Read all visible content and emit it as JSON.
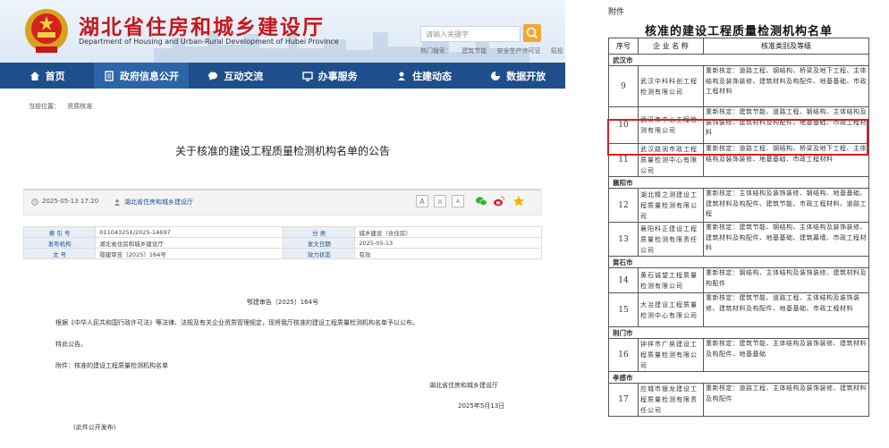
{
  "header": {
    "title": "湖北省住房和城乡建设厅",
    "subtitle": "Department of Housing and Urban-Rural Development of Hubei Province",
    "search_placeholder": "请输入关键字",
    "hotwords": [
      "热门搜索：",
      "建筑节能",
      "安全生产许可证",
      "招投",
      "业务"
    ]
  },
  "nav": {
    "items": [
      {
        "label": "首页",
        "icon": "home-icon"
      },
      {
        "label": "政府信息公开",
        "icon": "document-icon"
      },
      {
        "label": "互动交流",
        "icon": "chat-icon"
      },
      {
        "label": "办事服务",
        "icon": "monitor-icon"
      },
      {
        "label": "住建动态",
        "icon": "person-icon"
      },
      {
        "label": "数据开放",
        "icon": "pie-chart-icon"
      }
    ]
  },
  "breadcrumb": [
    "当前位置：",
    "资质核准"
  ],
  "article": {
    "title": "关于核准的建设工程质量检测机构名单的公告",
    "date": "2025-05-13 17:20",
    "source": "湖北省住房和城乡建设厅",
    "font_sizes": [
      "A",
      "A",
      "A"
    ],
    "info": {
      "index_label": "索 引 号",
      "index_value": "01104325X/2025-14697",
      "category_label": "分 类",
      "category_value": "城乡建设（含住房）",
      "issuer_label": "发布机构",
      "issuer_value": "湖北省住房和城乡建设厅",
      "pubdate_label": "发文日期",
      "pubdate_value": "2025-05-13",
      "docno_label": "文 号",
      "docno_value": "鄂建审告〔2025〕164号",
      "status_label": "效力状态",
      "status_value": "有效"
    },
    "doc_no": "鄂建审告〔2025〕164号",
    "body": "根据《中华人民共和国行政许可法》等法律、法规及有关企业资质管理规定，现将我厅核准的建设工程质量检测机构名单予以公布。",
    "notice": "特此公告。",
    "attachment": "附件：核准的建设工程质量检测机构名单",
    "signer": "湖北省住房和城乡建设厅",
    "sign_date": "2025年5月13日",
    "footer": "(此件公开发布)"
  },
  "attachment_table": {
    "label": "附件",
    "title": "核准的建设工程质量检测机构名单",
    "headers": [
      "序号",
      "企 业 名 称",
      "核准类别及等级"
    ],
    "groups": [
      {
        "city": "武汉市",
        "rows": [
          {
            "no": "9",
            "name": "武汉中科科创工程检测有限公司",
            "scope": "重新核定：道路工程、钢结构、桥梁及地下工程、主体结构及装饰装修、建筑材料及构配件、地基基础、市政工程材料"
          },
          {
            "no": "10",
            "name": "武汉市中心工程检测有限公司",
            "scope": "重新核定：建筑节能、道路工程、钢结构、主体结构及装饰装修、建筑材料及构配件、地基基础、市政工程材料"
          },
          {
            "no": "11",
            "name": "武汉路润市政工程质量检测中心有限公司",
            "scope": "重新核定：道路工程、钢结构、桥梁及地下工程、主体结构及装饰装修、地基基础、市政工程材料"
          }
        ]
      },
      {
        "city": "襄阳市",
        "rows": [
          {
            "no": "12",
            "name": "湖北精之测建设工程质量检测有限公司",
            "scope": "重新核定：主体结构及装饰装修、钢结构、地基基础、建筑材料及构配件、建筑节能、市政工程材料、道路工程"
          },
          {
            "no": "13",
            "name": "襄阳科正建设工程质量检测有限责任公司",
            "scope": "重新核定：建筑节能、钢结构、主体结构及装饰装修、建筑材料及构配件、地基基础、建筑幕墙、市政工程材料"
          }
        ]
      },
      {
        "city": "黄石市",
        "rows": [
          {
            "no": "14",
            "name": "黄石诚望工程质量检测有限公司",
            "scope": "重新核定：钢结构、主体结构及装饰装修、建筑材料及构配件"
          },
          {
            "no": "15",
            "name": "大冶建设工程质量检测中心有限公司",
            "scope": "重新核定：建筑节能、道路工程、主体结构及装饰装修、建筑材料及构配件、地基基础、市政工程材料"
          }
        ]
      },
      {
        "city": "荆门市",
        "rows": [
          {
            "no": "16",
            "name": "钟祥市广昊建设工程质量检测有限公司",
            "scope": "重新核定：建筑节能、主体结构及装饰装修、建筑材料及构配件、地基基础"
          }
        ]
      },
      {
        "city": "孝感市",
        "rows": [
          {
            "no": "17",
            "name": "应城市银龙建设工程质量检测有限责任公司",
            "scope": "重新核定：道路工程、主体结构及装饰装修、建筑材料及构配件"
          }
        ]
      }
    ]
  },
  "colors": {
    "brand_red": "#c8161d",
    "nav_blue": "#1f4e8c",
    "highlight_red": "#d0202a"
  }
}
